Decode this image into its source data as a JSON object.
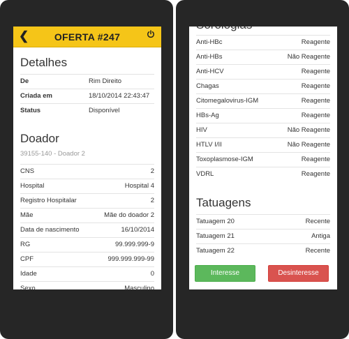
{
  "left": {
    "header": {
      "back_icon": "chevron-left-icon",
      "title": "OFERTA #247",
      "power_icon": "power-icon",
      "color": "#f5c518"
    },
    "detalhes": {
      "heading": "Detalhes",
      "rows": [
        {
          "label": "De",
          "value": "Rim Direito"
        },
        {
          "label": "Criada em",
          "value": "18/10/2014 22:43:47"
        },
        {
          "label": "Status",
          "value": "Disponível"
        }
      ]
    },
    "doador": {
      "heading": "Doador",
      "subtitle": "39155-140 - Doador 2",
      "rows": [
        {
          "label": "CNS",
          "value": "2"
        },
        {
          "label": "Hospital",
          "value": "Hospital 4"
        },
        {
          "label": "Registro Hospitalar",
          "value": "2"
        },
        {
          "label": "Mãe",
          "value": "Mãe do doador 2"
        },
        {
          "label": "Data de nascimento",
          "value": "16/10/2014"
        },
        {
          "label": "RG",
          "value": "99.999.999-9"
        },
        {
          "label": "CPF",
          "value": "999.999.999-99"
        },
        {
          "label": "Idade",
          "value": "0"
        },
        {
          "label": "Sexo",
          "value": "Masculino"
        }
      ]
    }
  },
  "right": {
    "sorologias": {
      "heading": "Sorologias",
      "rows": [
        {
          "label": "Anti-HBc",
          "value": "Reagente"
        },
        {
          "label": "Anti-HBs",
          "value": "Não Reagente"
        },
        {
          "label": "Anti-HCV",
          "value": "Reagente"
        },
        {
          "label": "Chagas",
          "value": "Reagente"
        },
        {
          "label": "Citomegalovirus-IGM",
          "value": "Reagente"
        },
        {
          "label": "HBs-Ag",
          "value": "Reagente"
        },
        {
          "label": "HIV",
          "value": "Não Reagente"
        },
        {
          "label": "HTLV I/II",
          "value": "Não Reagente"
        },
        {
          "label": "Toxoplasmose-IGM",
          "value": "Reagente"
        },
        {
          "label": "VDRL",
          "value": "Reagente"
        }
      ]
    },
    "tatuagens": {
      "heading": "Tatuagens",
      "rows": [
        {
          "label": "Tatuagem 20",
          "value": "Recente"
        },
        {
          "label": "Tatuagem 21",
          "value": "Antiga"
        },
        {
          "label": "Tatuagem 22",
          "value": "Recente"
        }
      ]
    },
    "buttons": {
      "interesse": "Interesse",
      "desinteresse": "Desinteresse"
    }
  }
}
